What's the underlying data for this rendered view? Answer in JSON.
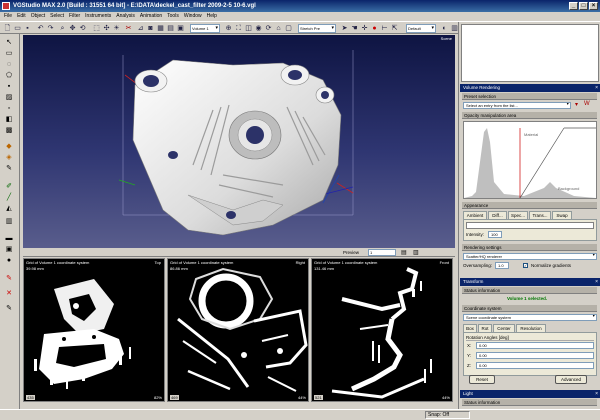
{
  "window": {
    "title": "VGStudio MAX 2.0 [Build : 31551 64 bit] - E:\\DATA\\deckel_cast_filter 2009-2-5 10-6.vgl"
  },
  "menu": [
    "File",
    "Edit",
    "Object",
    "Select",
    "Filter",
    "Instruments",
    "Analysis",
    "Animation",
    "Tools",
    "Window",
    "Help"
  ],
  "toolbar": {
    "objects_combo": "Volume 1",
    "zoom_combo": "Stretch Pre",
    "cursor_combo": "Default",
    "volume_combo": "Grid of Volu",
    "unit_combo": "mm"
  },
  "view3d": {
    "label": "Scene"
  },
  "preview": {
    "label": "Preview",
    "value": "1"
  },
  "slices": [
    {
      "title": "Grid of Volume 1 coordinate system",
      "scale": "39.98 mm",
      "corner": "Top",
      "coord": "435",
      "zoom": "82%"
    },
    {
      "title": "Grid of Volume 1 coordinate system",
      "scale": "86.86 mm",
      "corner": "Right",
      "coord": "469",
      "zoom": "44%"
    },
    {
      "title": "Grid of Volume 1 coordinate system",
      "scale": "131.46 mm",
      "corner": "Front",
      "coord": "521",
      "zoom": "44%"
    }
  ],
  "volume_rendering": {
    "panel_title": "Volume Rendering",
    "preset_section": "Preset selection",
    "preset_placeholder": "Select an entry from the list...",
    "opacity_section": "Opacity manipulation area",
    "opacity_label_top": "Material",
    "opacity_label_right": "Background",
    "appearance_section": "Appearance",
    "tabs": [
      "Ambient",
      "Diff...",
      "Spec...",
      "Trans...",
      "Swap"
    ],
    "intensity_label": "Intensity:",
    "intensity_value": "100",
    "rendering_section": "Rendering settings",
    "renderer": "Scatter/HQ renderer",
    "oversampling_label": "Oversampling:",
    "oversampling_value": "1.0",
    "normalize_label": "Normalize gradients",
    "normalize_checked": true
  },
  "transform": {
    "panel_title": "Transform",
    "status_section": "Status information",
    "status_text": "Volume 1 selected.",
    "coord_section": "Coordinate system",
    "coord_value": "Scene coordinate system",
    "tabs": [
      "Box",
      "Rot",
      "Center",
      "Resolution"
    ],
    "rotation_section": "Rotation Angles [deg]",
    "axes": [
      {
        "axis": "X:",
        "value": "0.00"
      },
      {
        "axis": "Y:",
        "value": "0.00"
      },
      {
        "axis": "Z:",
        "value": "0.00"
      }
    ],
    "reset_button": "Reset",
    "advanced_button": "Advanced"
  },
  "light": {
    "panel_title": "Light",
    "status_section": "Status information"
  },
  "statusbar": {
    "snap": "Snap: Off"
  },
  "colors": {
    "title_bar": "#0a246a",
    "panel_header": "#0a246a",
    "selected_text": "#007700"
  }
}
